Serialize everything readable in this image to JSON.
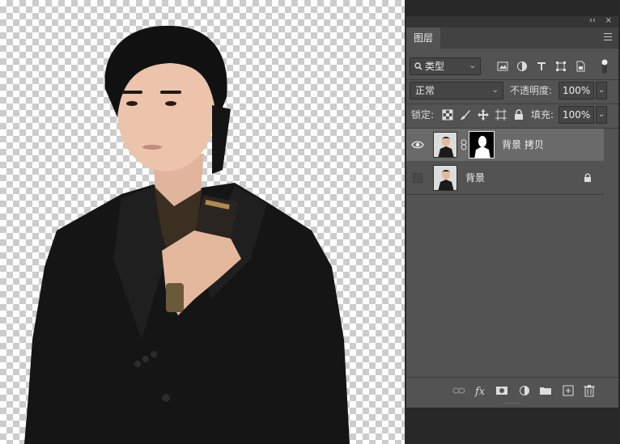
{
  "canvas": {
    "content": "person-cutout-on-transparency"
  },
  "panel": {
    "collapse": "‹‹",
    "close": "×",
    "tab_label": "图层",
    "filter_label": "类型",
    "blend_mode": "正常",
    "opacity_label": "不透明度:",
    "opacity_value": "100%",
    "lock_label": "锁定:",
    "fill_label": "填充:",
    "fill_value": "100%",
    "dropdown": "⌄"
  },
  "layers": [
    {
      "name": "背景 拷贝",
      "visible": true,
      "selected": true,
      "has_mask": true
    },
    {
      "name": "背景",
      "visible": false,
      "selected": false,
      "locked": true
    }
  ],
  "footer_icons": [
    "link-icon",
    "fx-icon",
    "mask-icon",
    "adjustment-icon",
    "folder-icon",
    "new-layer-icon",
    "trash-icon"
  ],
  "colors": {
    "panel": "#535353",
    "selected_layer": "#6a6a6a",
    "background": "#282828"
  }
}
